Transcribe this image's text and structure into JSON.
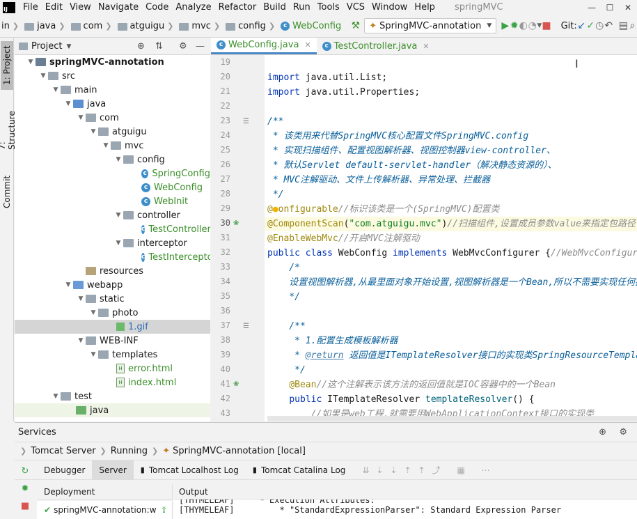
{
  "menu": {
    "items": [
      "File",
      "Edit",
      "View",
      "Navigate",
      "Code",
      "Analyze",
      "Refactor",
      "Build",
      "Run",
      "Tools",
      "VCS",
      "Window",
      "Help"
    ],
    "app_title": "springMVC"
  },
  "breadcrumb": [
    "in",
    "java",
    "com",
    "atguigu",
    "mvc",
    "config",
    "WebConfig"
  ],
  "run_config": "SpringMVC-annotation",
  "git_label": "Git:",
  "left_tabs": [
    "1: Project",
    "7: Structure",
    "Commit"
  ],
  "project_panel": {
    "title": "Project",
    "items": [
      {
        "label": "springMVC-annotation",
        "bold": true
      },
      {
        "label": "src"
      },
      {
        "label": "main"
      },
      {
        "label": "java"
      },
      {
        "label": "com"
      },
      {
        "label": "atguigu"
      },
      {
        "label": "mvc"
      },
      {
        "label": "config"
      },
      {
        "label": "SpringConfig"
      },
      {
        "label": "WebConfig"
      },
      {
        "label": "WebInit"
      },
      {
        "label": "controller"
      },
      {
        "label": "TestController"
      },
      {
        "label": "interceptor"
      },
      {
        "label": "TestInterceptor"
      },
      {
        "label": "resources"
      },
      {
        "label": "webapp"
      },
      {
        "label": "static"
      },
      {
        "label": "photo"
      },
      {
        "label": "1.gif"
      },
      {
        "label": "WEB-INF"
      },
      {
        "label": "templates"
      },
      {
        "label": "error.html"
      },
      {
        "label": "index.html"
      },
      {
        "label": "test"
      },
      {
        "label": "java"
      }
    ]
  },
  "editor": {
    "tabs": [
      {
        "label": "WebConfig.java",
        "active": true
      },
      {
        "label": "TestController.java",
        "active": false
      }
    ],
    "line_numbers": [
      "19",
      "20",
      "21",
      "22",
      "23",
      "24",
      "25",
      "26",
      "27",
      "28",
      "29",
      "30",
      "31",
      "32",
      "33",
      "34",
      "35",
      "36",
      "37",
      "38",
      "39",
      "40",
      "41",
      "42",
      "43"
    ],
    "current_line": "30"
  },
  "services": {
    "title": "Services",
    "crumbs": [
      "Tomcat Server",
      "Running",
      "SpringMVC-annotation [local]"
    ],
    "tabs": [
      "Debugger",
      "Server",
      "Tomcat Localhost Log",
      "Tomcat Catalina Log"
    ],
    "deployment_header": "Deployment",
    "output_header": "Output",
    "deployment_item": "springMVC-annotation:w",
    "output_lines": [
      "[THYMELEAF]     * Execution Attributes:",
      "[THYMELEAF]         * \"StandardExpressionParser\": Standard Expression Parser"
    ]
  }
}
